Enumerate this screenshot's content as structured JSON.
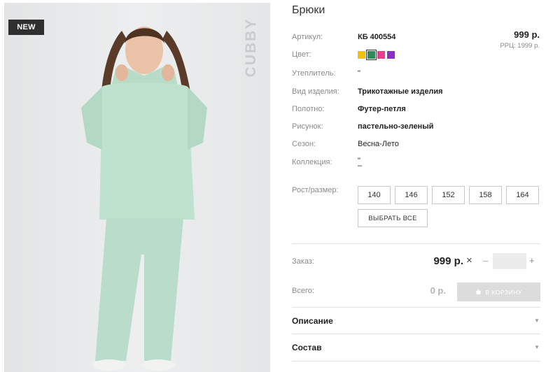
{
  "product": {
    "badge": "NEW",
    "brand": "CUBBY",
    "title": "Брюки",
    "price": "999 р.",
    "rrp": "РРЦ: 1999 р."
  },
  "attributes": {
    "article_label": "Артикул:",
    "article_value": "КБ 400554",
    "color_label": "Цвет:",
    "insulation_label": "Утеплитель:",
    "insulation_value": "\"",
    "type_label": "Вид изделия:",
    "type_value": "Трикотажные изделия",
    "fabric_label": "Полотно:",
    "fabric_value": "Футер-петля",
    "pattern_label": "Рисунок:",
    "pattern_value": "пастельно-зеленый",
    "season_label": "Сезон:",
    "season_value": "Весна-Лето",
    "collection_label": "Коллекция:",
    "collection_value": "\"",
    "collection_value2": "–"
  },
  "colors": [
    {
      "name": "yellow",
      "hex": "#f2c10b",
      "selected": false
    },
    {
      "name": "green",
      "hex": "#2e8b57",
      "selected": true
    },
    {
      "name": "pink",
      "hex": "#e83e8c",
      "selected": false
    },
    {
      "name": "purple",
      "hex": "#8b2fc9",
      "selected": false
    }
  ],
  "sizes": {
    "label": "Рост/размер:",
    "options": [
      "140",
      "146",
      "152",
      "158",
      "164"
    ],
    "select_all": "ВЫБРАТЬ ВСЕ"
  },
  "order": {
    "label": "Заказ:",
    "price": "999 р.",
    "times": "×",
    "minus": "–",
    "plus": "+",
    "quantity": ""
  },
  "total": {
    "label": "Всего:",
    "value": "0 р.",
    "cart_label": "В КОРЗИНУ"
  },
  "accordion": {
    "description": "Описание",
    "composition": "Состав"
  }
}
